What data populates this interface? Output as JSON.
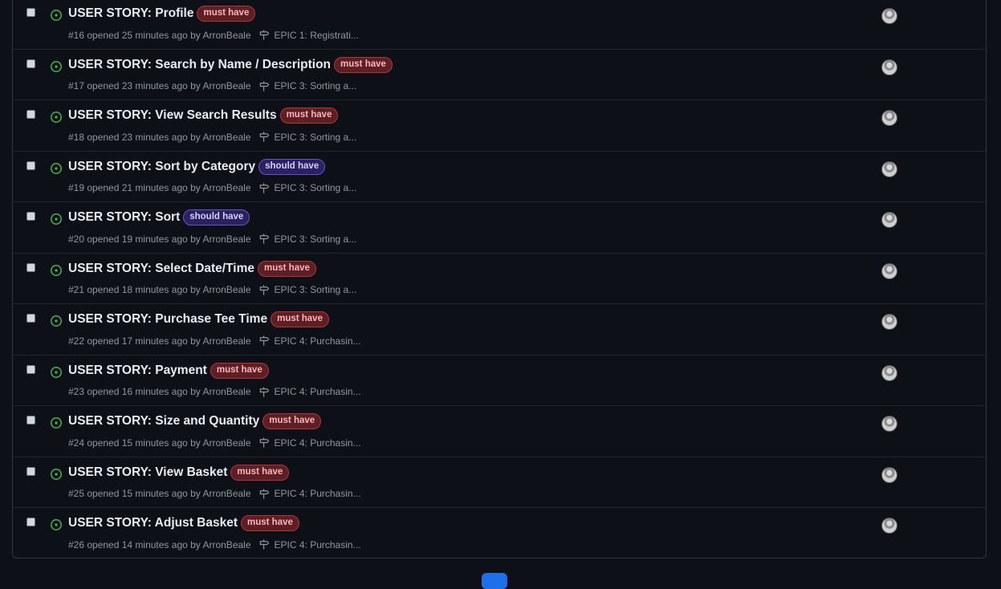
{
  "issues": [
    {
      "title": "USER STORY: Profile",
      "label": "must have",
      "label_type": "must",
      "meta": "#16 opened 25 minutes ago by ArronBeale",
      "milestone": "EPIC 1: Registrati..."
    },
    {
      "title": "USER STORY: Search by Name / Description",
      "label": "must have",
      "label_type": "must",
      "meta": "#17 opened 23 minutes ago by ArronBeale",
      "milestone": "EPIC 3: Sorting a..."
    },
    {
      "title": "USER STORY: View Search Results",
      "label": "must have",
      "label_type": "must",
      "meta": "#18 opened 23 minutes ago by ArronBeale",
      "milestone": "EPIC 3: Sorting a..."
    },
    {
      "title": "USER STORY: Sort by Category",
      "label": "should have",
      "label_type": "should",
      "meta": "#19 opened 21 minutes ago by ArronBeale",
      "milestone": "EPIC 3: Sorting a..."
    },
    {
      "title": "USER STORY: Sort",
      "label": "should have",
      "label_type": "should",
      "meta": "#20 opened 19 minutes ago by ArronBeale",
      "milestone": "EPIC 3: Sorting a..."
    },
    {
      "title": "USER STORY: Select Date/Time",
      "label": "must have",
      "label_type": "must",
      "meta": "#21 opened 18 minutes ago by ArronBeale",
      "milestone": "EPIC 3: Sorting a..."
    },
    {
      "title": "USER STORY: Purchase Tee Time",
      "label": "must have",
      "label_type": "must",
      "meta": "#22 opened 17 minutes ago by ArronBeale",
      "milestone": "EPIC 4: Purchasin..."
    },
    {
      "title": "USER STORY: Payment",
      "label": "must have",
      "label_type": "must",
      "meta": "#23 opened 16 minutes ago by ArronBeale",
      "milestone": "EPIC 4: Purchasin..."
    },
    {
      "title": "USER STORY: Size and Quantity",
      "label": "must have",
      "label_type": "must",
      "meta": "#24 opened 15 minutes ago by ArronBeale",
      "milestone": "EPIC 4: Purchasin..."
    },
    {
      "title": "USER STORY: View Basket",
      "label": "must have",
      "label_type": "must",
      "meta": "#25 opened 15 minutes ago by ArronBeale",
      "milestone": "EPIC 4: Purchasin..."
    },
    {
      "title": "USER STORY: Adjust Basket",
      "label": "must have",
      "label_type": "must",
      "meta": "#26 opened 14 minutes ago by ArronBeale",
      "milestone": "EPIC 4: Purchasin..."
    }
  ],
  "icons": {
    "status": "issue-opened-icon",
    "milestone": "milestone-icon",
    "assignee": "avatar"
  },
  "colors": {
    "open": "#3fb950",
    "must_label": "#b3353c",
    "should_label": "#6654c9",
    "pagination_accent": "#1f6feb"
  }
}
